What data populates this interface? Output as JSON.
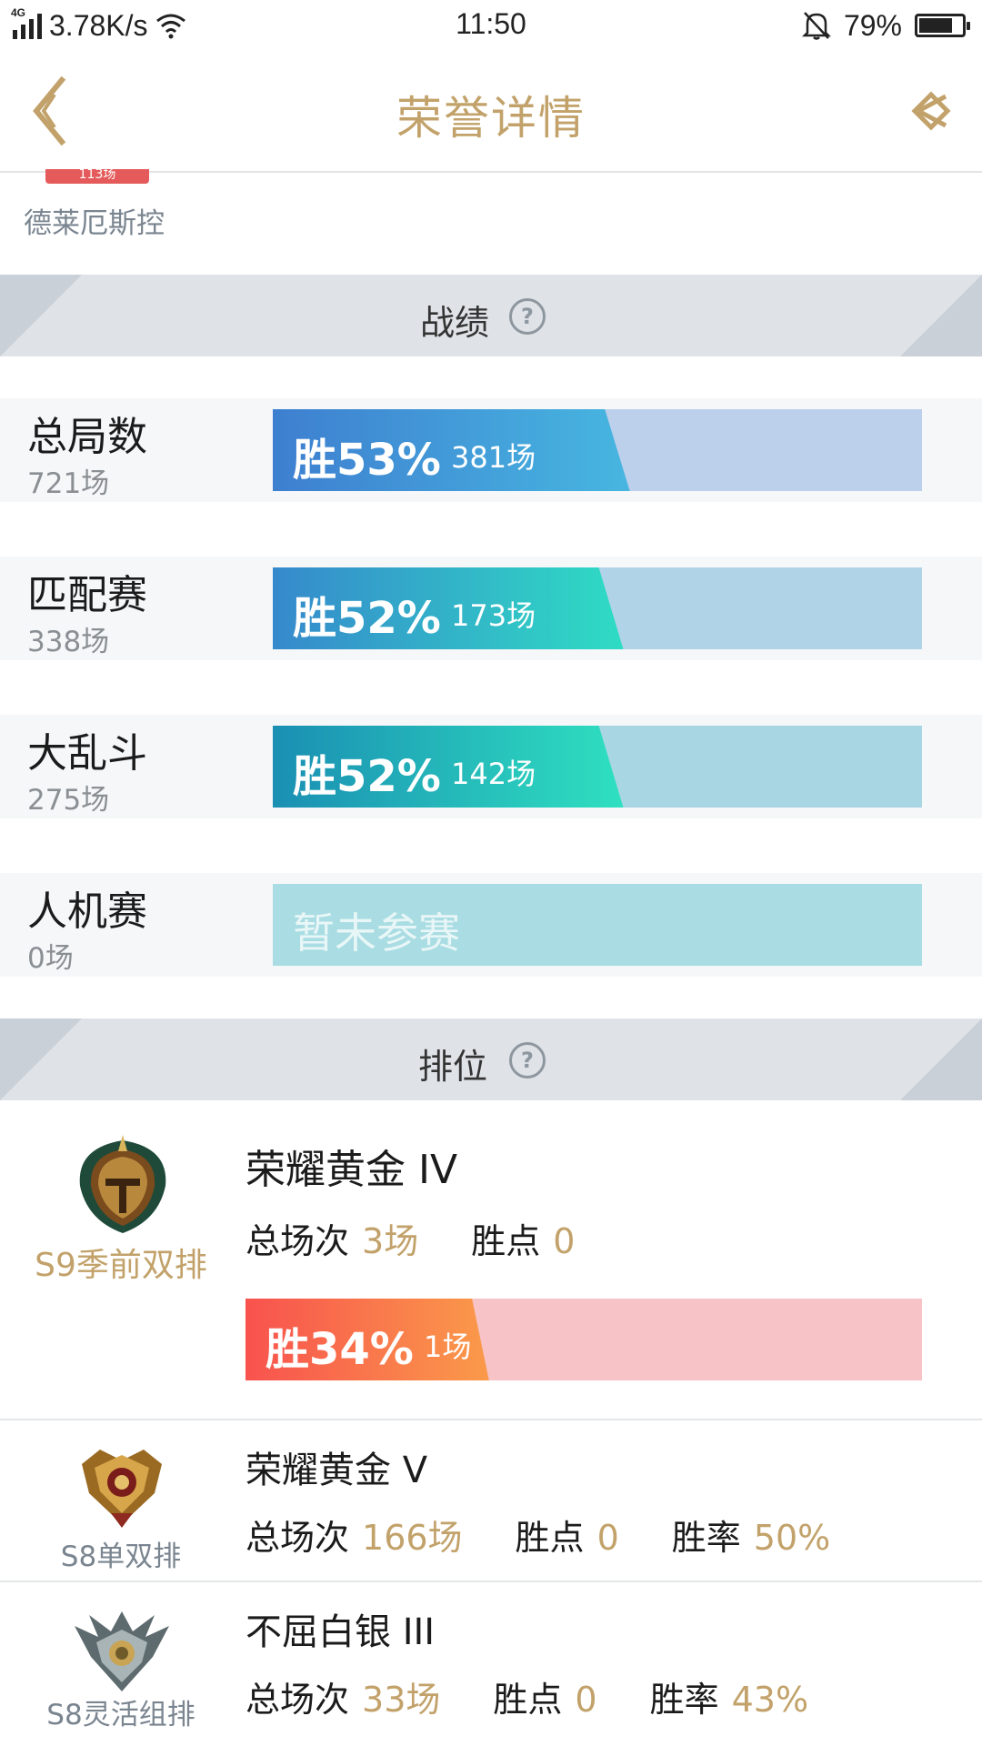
{
  "status_bar": {
    "network_type": "4G",
    "speed": "3.78K/s",
    "time": "11:50",
    "battery": "79%",
    "battery_level": 0.79
  },
  "header": {
    "title": "荣誉详情",
    "back_icon": "chevron-left-icon",
    "share_icon": "share-icon",
    "accent_color": "#c2a26a"
  },
  "champion": {
    "badge": "113场",
    "name": "德莱厄斯控"
  },
  "record_section": {
    "title": "战绩",
    "help_symbol": "?",
    "rows": [
      {
        "name": "总局数",
        "count": "721场",
        "win_label": "胜53%",
        "wins": "381场",
        "win_fraction": 0.53
      },
      {
        "name": "匹配赛",
        "count": "338场",
        "win_label": "胜52%",
        "wins": "173场",
        "win_fraction": 0.52
      },
      {
        "name": "大乱斗",
        "count": "275场",
        "win_label": "胜52%",
        "wins": "142场",
        "win_fraction": 0.52
      },
      {
        "name": "人机赛",
        "count": "0场",
        "empty_label": "暂未参赛"
      }
    ]
  },
  "rank_section": {
    "title": "排位",
    "help_symbol": "?",
    "current": {
      "queue": "S9季前双排",
      "tier": "荣耀黄金 IV",
      "total_label": "总场次",
      "total": "3场",
      "points_label": "胜点",
      "points": "0",
      "win_label": "胜34%",
      "wins": "1场",
      "win_fraction": 0.34
    },
    "history": [
      {
        "queue": "S8单双排",
        "tier": "荣耀黄金 V",
        "total_label": "总场次",
        "total": "166场",
        "points_label": "胜点",
        "points": "0",
        "rate_label": "胜率",
        "rate": "50%"
      },
      {
        "queue": "S8灵活组排",
        "tier": "不屈白银 III",
        "total_label": "总场次",
        "total": "33场",
        "points_label": "胜点",
        "points": "0",
        "rate_label": "胜率",
        "rate": "43%"
      }
    ]
  }
}
